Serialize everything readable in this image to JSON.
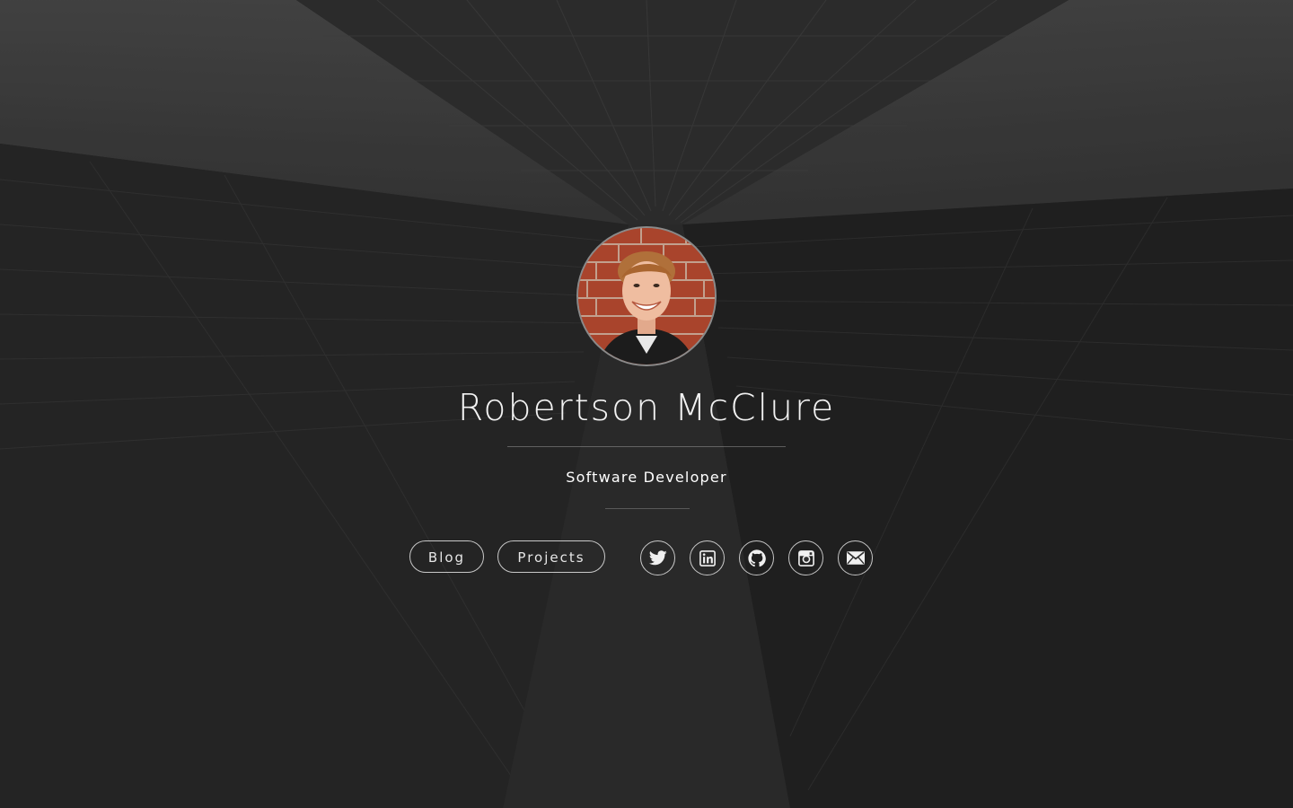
{
  "profile": {
    "name": "Robertson McClure",
    "title": "Software Developer",
    "avatar_icon": "profile-photo"
  },
  "nav": {
    "blog_label": "Blog",
    "projects_label": "Projects"
  },
  "social": [
    {
      "name": "twitter",
      "icon": "twitter-icon"
    },
    {
      "name": "linkedin",
      "icon": "linkedin-icon"
    },
    {
      "name": "github",
      "icon": "github-icon"
    },
    {
      "name": "instagram",
      "icon": "instagram-icon"
    },
    {
      "name": "email",
      "icon": "mail-icon"
    }
  ],
  "colors": {
    "background": "#2a2a2a",
    "text": "#f2f2f2",
    "outline": "#bfbfbf",
    "avatar_brick": "#b04a30"
  }
}
